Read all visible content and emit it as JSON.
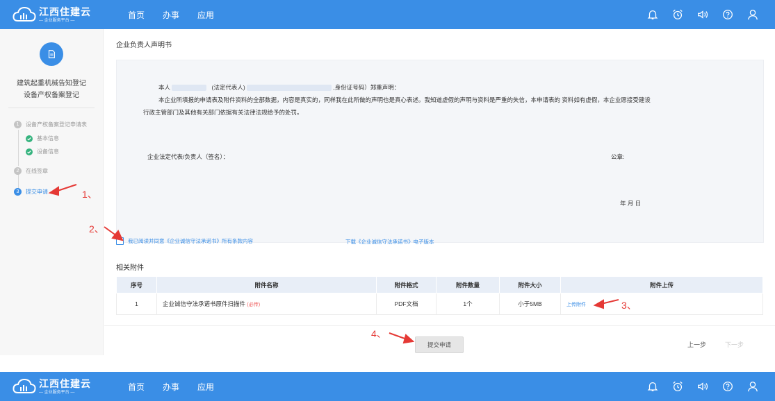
{
  "app": {
    "logo_title": "江西住建云",
    "logo_subtitle": "— 企业服务平台 —"
  },
  "nav": {
    "items": [
      {
        "label": "首页"
      },
      {
        "label": "办事"
      },
      {
        "label": "应用"
      }
    ]
  },
  "sidebar": {
    "title_line1": "建筑起重机械告知登记",
    "title_line2": "设备产权备案登记",
    "steps": [
      {
        "num": "1",
        "label": "设备产权备案登记申请表"
      },
      {
        "num": "2",
        "label": "在线签章"
      },
      {
        "num": "3",
        "label": "提交申请"
      }
    ],
    "substeps": [
      {
        "label": "基本信息"
      },
      {
        "label": "设备信息"
      }
    ]
  },
  "declaration": {
    "title": "企业负责人声明书",
    "line1_a": "本人",
    "line1_b": "(法定代表人)",
    "line1_c": ",身份证号码）郑重声明：",
    "line2": "本企业所填报的申请表及附件资料的全部数据，内容是真实的，同样我在此所做的声明也是真心表述。我知道虚假的声明与资料是严重的失信，本申请表的 资料如有虚假，本企业愿接受建设",
    "line3": "行政主管部门及其他有关部门依据有关法律法规给予的处罚。",
    "signature_label": "企业法定代表/负责人（签名）：",
    "seal_label": "公章:",
    "date_label": "年   月   日"
  },
  "agree": {
    "checkbox_label": "我已阅读并同意《企业诚信守法承诺书》所有条款内容",
    "download_link": "下载《企业诚信守法承诺书》电子版本"
  },
  "attachments": {
    "title": "相关附件",
    "headers": [
      "序号",
      "附件名称",
      "附件格式",
      "附件数量",
      "附件大小",
      "附件上传"
    ],
    "rows": [
      {
        "index": "1",
        "name": "企业诚信守法承诺书原件扫描件",
        "required": "(必传)",
        "format": "PDF文档",
        "count": "1个",
        "size": "小于5MB",
        "upload": "上传附件"
      }
    ]
  },
  "footer": {
    "submit": "提交申请",
    "prev": "上一步",
    "next": "下一步"
  },
  "annotations": {
    "a1": "1、",
    "a2": "2、",
    "a3": "3、",
    "a4": "4、"
  },
  "colors": {
    "brand": "#3a8ee6",
    "annotation": "#e53935",
    "required": "#e55555"
  }
}
